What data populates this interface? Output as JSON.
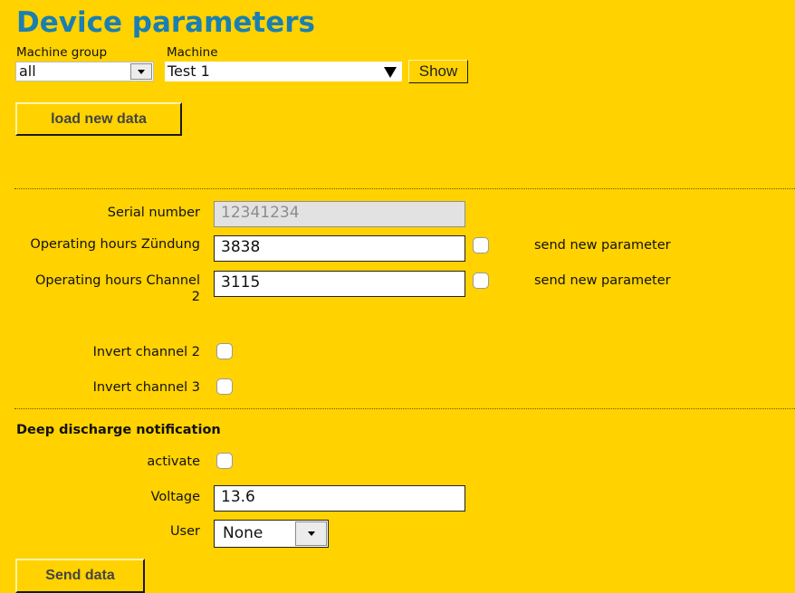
{
  "page": {
    "title": "Device parameters"
  },
  "filters": {
    "machine_group_label": "Machine group",
    "machine_group_value": "all",
    "machine_label": "Machine",
    "machine_value": "Test 1",
    "show_label": "Show"
  },
  "actions": {
    "load_label": "load new data",
    "send_label": "Send data"
  },
  "params": {
    "serial_label": "Serial number",
    "serial_value": "12341234",
    "op_ignition_label": "Operating hours Zündung",
    "op_ignition_value": "3838",
    "op_channel2_label_line1": "Operating hours Channel",
    "op_channel2_label_line2": "2",
    "op_channel2_value": "3115",
    "send_new_parameter_1": "send new parameter",
    "send_new_parameter_2": "send new parameter",
    "invert_ch2_label": "Invert channel 2",
    "invert_ch3_label": "Invert channel 3"
  },
  "deep_discharge": {
    "title": "Deep discharge notification",
    "activate_label": "activate",
    "voltage_label": "Voltage",
    "voltage_value": "13.6",
    "user_label": "User",
    "user_value": "None"
  },
  "icons": {
    "dropdown": "chevron-down-icon",
    "machine_dropdown": "triangle-down-icon"
  }
}
